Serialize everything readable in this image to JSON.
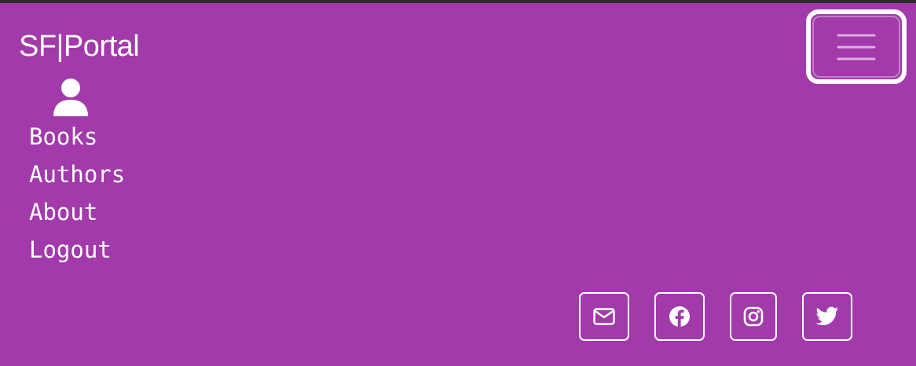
{
  "brand": {
    "name": "SF|Portal"
  },
  "navbar": {
    "toggler_icon": "hamburger-menu-icon"
  },
  "user": {
    "avatar_icon": "user-icon"
  },
  "nav": {
    "items": [
      {
        "label": "Books"
      },
      {
        "label": "Authors"
      },
      {
        "label": "About"
      },
      {
        "label": "Logout"
      }
    ]
  },
  "social": [
    {
      "icon": "envelope-icon"
    },
    {
      "icon": "facebook-icon"
    },
    {
      "icon": "instagram-icon"
    },
    {
      "icon": "twitter-icon"
    }
  ],
  "colors": {
    "background": "#a23aab",
    "foreground": "#ffffff",
    "top_edge": "#2c2c2c"
  }
}
